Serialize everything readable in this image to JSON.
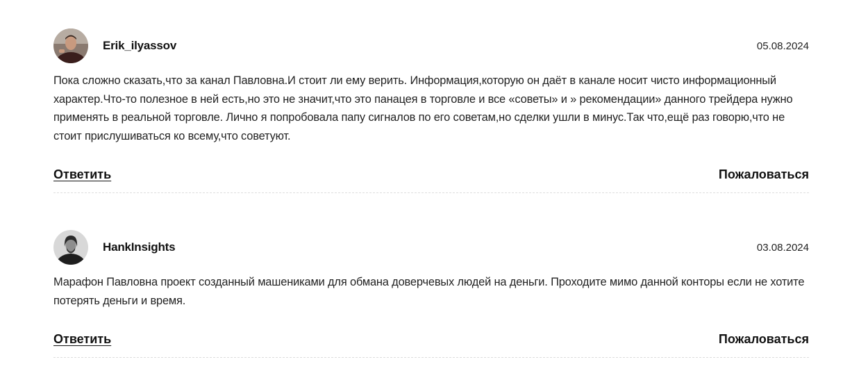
{
  "comments": [
    {
      "author": "Erik_ilyassov",
      "date": "05.08.2024",
      "text": "Пока сложно сказать,что за канал Павловна.И стоит ли ему верить. Информация,которую он даёт в канале носит чисто информационный характер.Что-то полезное в ней есть,но это не значит,что это панацея в торговле и все «советы» и » рекомендации» данного трейдера нужно применять в реальной торговле. Лично я попробовала папу сигналов по его советам,но сделки ушли в минус.Так что,ещё раз говорю,что не стоит прислушиваться ко всему,что советуют.",
      "reply_label": "Ответить",
      "report_label": "Пожаловаться",
      "avatar_icon": "user-photo-avatar"
    },
    {
      "author": "HankInsights",
      "date": "03.08.2024",
      "text": "Марафон Павловна проект созданный машениками для обмана доверчевых людей на деньги. Проходите мимо данной конторы если не хотите потерять деньги и время.",
      "reply_label": "Ответить",
      "report_label": "Пожаловаться",
      "avatar_icon": "user-photo-avatar"
    }
  ]
}
